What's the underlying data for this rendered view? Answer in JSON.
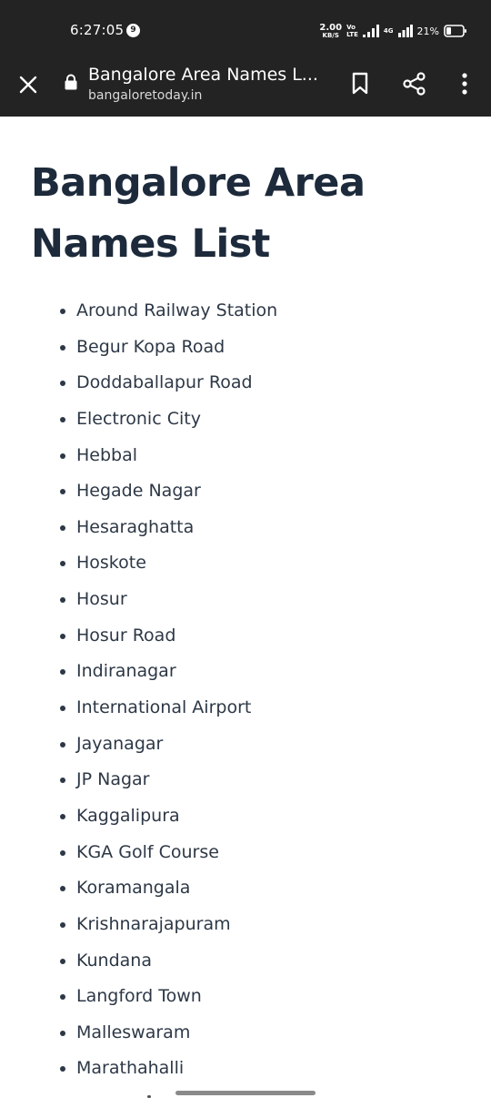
{
  "status_bar": {
    "time": "6:27:05",
    "notification_count": "9",
    "net_speed_value": "2.00",
    "net_speed_unit": "KB/S",
    "volte_top": "Vo",
    "volte_bottom": "LTE",
    "network_type": "4G",
    "battery_percent": "21%"
  },
  "toolbar": {
    "page_title": "Bangalore Area Names L...",
    "url": "bangaloretoday.in"
  },
  "article": {
    "title_line1": "Bangalore Area",
    "title_line2": "Names List",
    "areas": [
      "Around Railway Station",
      "Begur Kopa Road",
      "Doddaballapur Road",
      "Electronic City",
      "Hebbal",
      "Hegade Nagar",
      "Hesaraghatta",
      "Hoskote",
      "Hosur",
      "Hosur Road",
      "Indiranagar",
      "International Airport",
      "Jayanagar",
      "JP Nagar",
      "Kaggalipura",
      "KGA Golf Course",
      "Koramangala",
      "Krishnarajapuram",
      "Kundana",
      "Langford Town",
      "Malleswaram",
      "Marathahalli"
    ]
  },
  "icons": {
    "close": "close-icon",
    "lock": "lock-icon",
    "bookmark": "bookmark-icon",
    "share": "share-icon",
    "menu": "more-vertical-icon"
  },
  "colors": {
    "toolbar_bg": "#232323",
    "title_color": "#1d2a3b",
    "list_text": "#2d3846"
  }
}
